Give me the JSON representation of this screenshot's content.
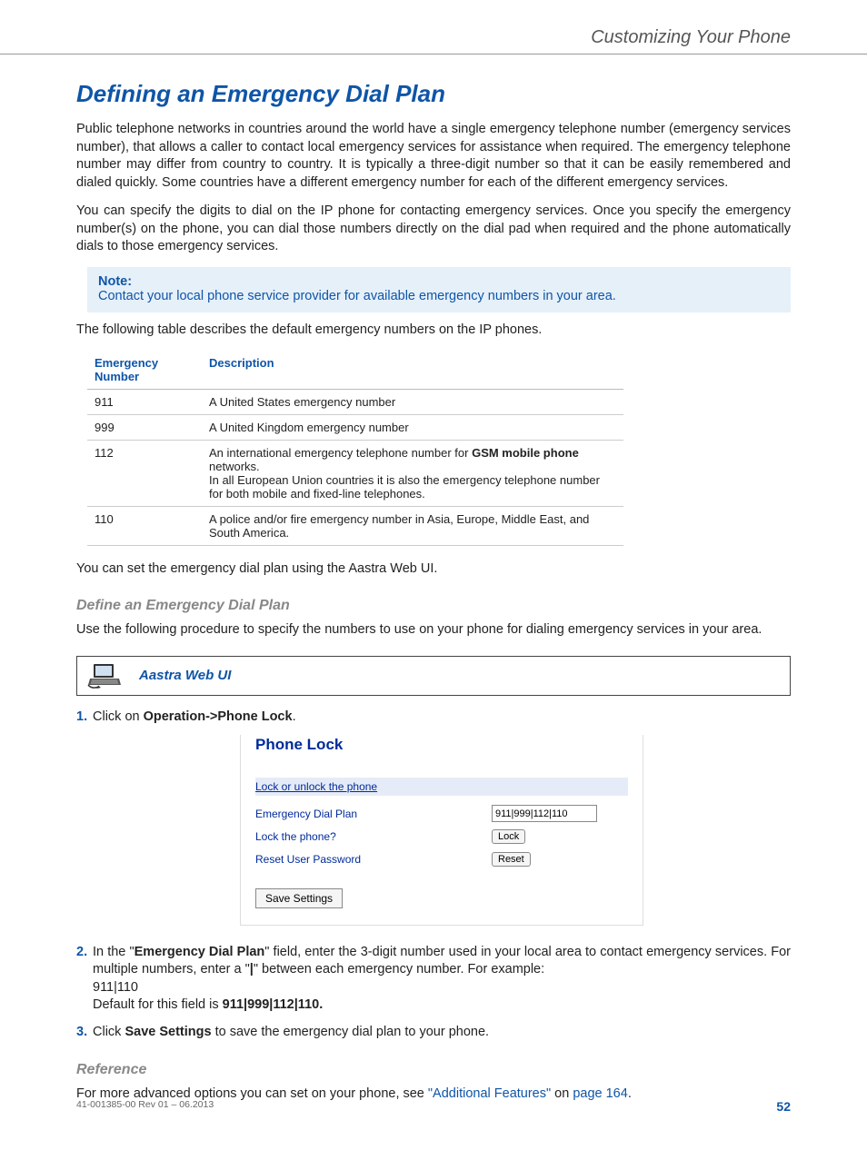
{
  "header": {
    "title": "Customizing Your Phone"
  },
  "section": {
    "heading": "Defining an Emergency Dial Plan",
    "para1": "Public telephone networks in countries around the world have a single emergency telephone number (emergency services number), that allows a caller to contact local emergency services for assistance when required. The emergency telephone number may differ from country to country. It is typically a three-digit number so that it can be easily remembered and dialed quickly. Some countries have a different emergency number for each of the different emergency services.",
    "para2": "You can specify the digits to dial on the IP phone for contacting emergency services. Once you specify the emergency number(s) on the phone, you can dial those numbers directly on the dial pad when required and the phone automatically dials to those emergency services.",
    "note_title": "Note:",
    "note_text": "Contact your local phone service provider for available emergency numbers in your area.",
    "table_intro": "The following table describes the default emergency numbers on the IP phones.",
    "table_header_number": "Emergency Number",
    "table_header_desc": "Description",
    "rows": [
      {
        "num": "911",
        "desc": "A United States emergency number"
      },
      {
        "num": "999",
        "desc": "A United Kingdom emergency number"
      },
      {
        "num": "112",
        "desc_pre": "An international emergency telephone number for ",
        "desc_bold": "GSM mobile phone",
        "desc_post": " networks.",
        "desc_line2": "In all European Union countries it is also the emergency telephone number for both mobile and fixed-line telephones."
      },
      {
        "num": "110",
        "desc": "A police and/or fire emergency number in Asia, Europe, Middle East, and South America."
      }
    ],
    "after_table": "You can set the emergency dial plan using the Aastra Web UI."
  },
  "define": {
    "heading": "Define an Emergency Dial Plan",
    "intro": "Use the following procedure to specify the numbers to use on your phone for dialing emergency services in your area.",
    "webui_label": "Aastra Web UI"
  },
  "steps": {
    "s1_pre": "Click on ",
    "s1_bold": "Operation->Phone Lock",
    "s1_post": ".",
    "s2_pre": "In the \"",
    "s2_bold1": "Emergency Dial Plan",
    "s2_mid": "\" field, enter the 3-digit number used in your local area to contact emergency services. For multiple numbers, enter a \"",
    "s2_pipe": "|",
    "s2_mid2": "\" between each emergency number. For example:",
    "s2_example": "911|110",
    "s2_default_pre": "Default for this field is ",
    "s2_default_bold": "911|999|112|110.",
    "s3_pre": "Click ",
    "s3_bold": "Save Settings",
    "s3_post": " to save the emergency dial plan to your phone."
  },
  "screenshot": {
    "title": "Phone Lock",
    "subhead": "Lock or unlock the phone",
    "label_plan": "Emergency Dial Plan",
    "value_plan": "911|999|112|110",
    "label_lock": "Lock the phone?",
    "btn_lock": "Lock",
    "label_reset": "Reset User Password",
    "btn_reset": "Reset",
    "btn_save": "Save Settings"
  },
  "reference": {
    "heading": "Reference",
    "text_pre": "For more advanced options you can set on your phone, see ",
    "link1": "\"Additional Features\"",
    "text_mid": " on ",
    "link2": "page 164",
    "text_post": "."
  },
  "footer": {
    "left": "41-001385-00 Rev 01 – 06.2013",
    "right": "52"
  }
}
